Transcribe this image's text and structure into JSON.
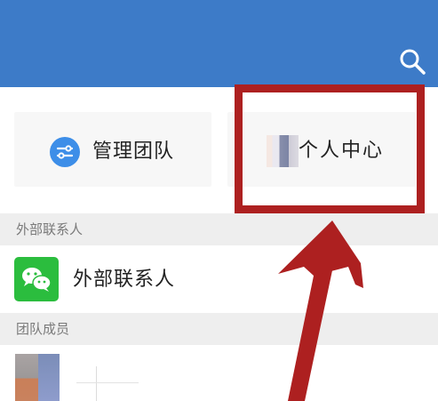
{
  "colors": {
    "topbar": "#3d7bc8",
    "card_bg": "#f7f7f7",
    "section_bg": "#eeeeee",
    "manage_icon": "#3d8ee8",
    "wechat_icon": "#2bbd3e",
    "highlight": "#ad2020"
  },
  "header": {
    "search_icon": "search-icon"
  },
  "quick_actions": {
    "manage_team_label": "管理团队",
    "manage_team_icon": "sliders-icon",
    "personal_center_label": "个人中心"
  },
  "sections": {
    "external_contacts_header": "外部联系人",
    "external_contact_item": "外部联系人",
    "external_contact_icon": "wechat-icon",
    "team_members_header": "团队成员"
  }
}
